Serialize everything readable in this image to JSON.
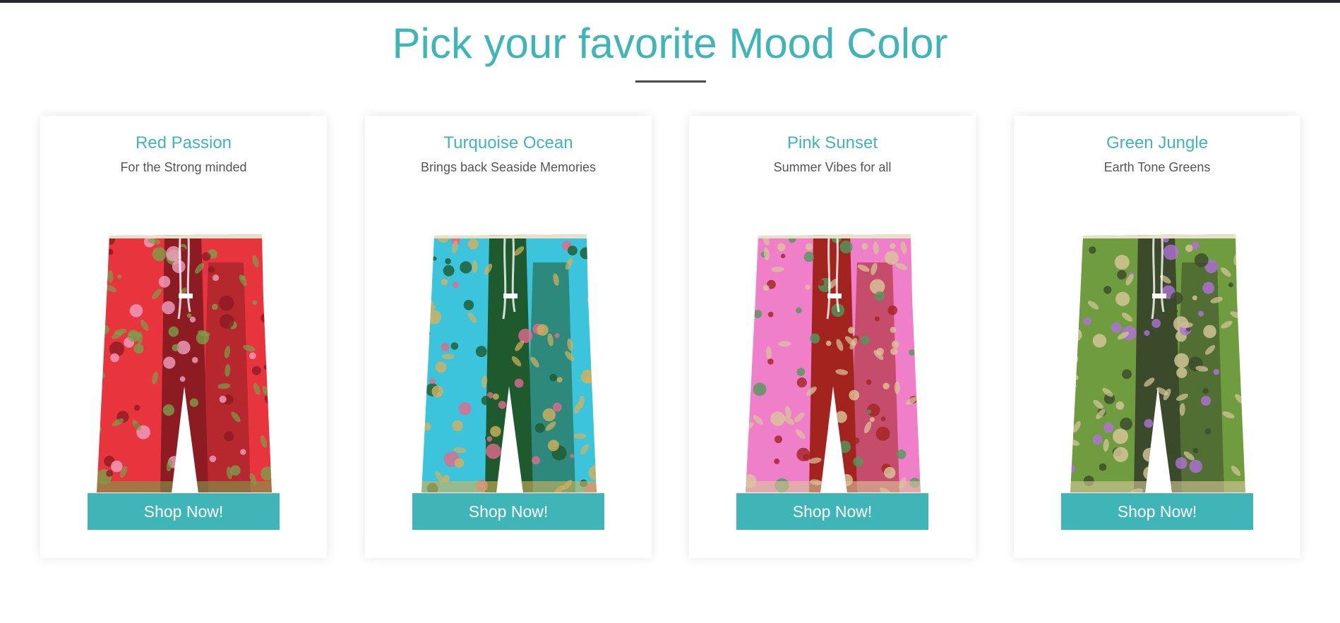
{
  "heading": "Pick your favorite Mood Color",
  "cards": [
    {
      "title": "Red Passion",
      "subtitle": "For the Strong minded",
      "button": "Shop Now!",
      "colors": {
        "base": "#e8353d",
        "panel": "#8c1c22",
        "accent": "#7ba04a",
        "flower": "#f0a0c0"
      }
    },
    {
      "title": "Turquoise Ocean",
      "subtitle": "Brings back Seaside Memories",
      "button": "Shop Now!",
      "colors": {
        "base": "#3cc4dc",
        "panel": "#1f5a2e",
        "accent": "#d6b05a",
        "flower": "#e26a8c"
      }
    },
    {
      "title": "Pink Sunset",
      "subtitle": "Summer Vibes for all",
      "button": "Shop Now!",
      "colors": {
        "base": "#ef7fc8",
        "panel": "#a3241f",
        "accent": "#d9c79a",
        "flower": "#4f9a5a"
      }
    },
    {
      "title": "Green Jungle",
      "subtitle": "Earth Tone Greens",
      "button": "Shop Now!",
      "colors": {
        "base": "#6f9c3f",
        "panel": "#3a4a2a",
        "accent": "#d8c89a",
        "flower": "#b070d8"
      }
    }
  ],
  "accent_color": "#3fb5b7"
}
